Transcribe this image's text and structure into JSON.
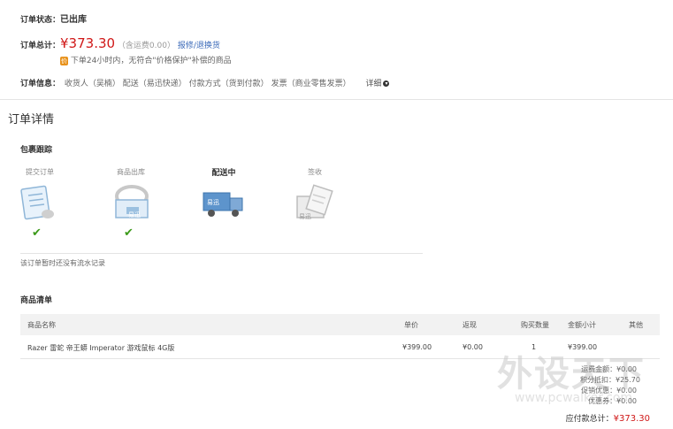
{
  "order": {
    "status_label": "订单状态：",
    "status_value": "已出库",
    "total_label": "订单总计：",
    "total_value": "¥373.30",
    "freight_note": "（含运费0.00）",
    "repair_link": "报修/退换货",
    "guarantee_text": "下单24小时内，无符合\"价格保护\"补偿的商品",
    "guarantee_icon_char": "价",
    "info_label": "订单信息：",
    "info_items": [
      "收货人（吴楠）",
      "配送（易迅快递）",
      "付款方式（货到付款）",
      "发票（商业零售发票）"
    ],
    "detail_label": "详细",
    "detail_icon_char": "▾"
  },
  "details": {
    "title": "订单详情",
    "tracking_title": "包裹跟踪",
    "steps": [
      {
        "label": "提交订单",
        "done": true
      },
      {
        "label": "商品出库",
        "done": true
      },
      {
        "label": "配送中",
        "done": false,
        "current": true
      },
      {
        "label": "签收",
        "done": false
      }
    ],
    "check_char": "✔",
    "no_records": "该订单暂时还没有流水记录",
    "brand_tag": "易迅"
  },
  "product_list": {
    "title": "商品清单",
    "headers": {
      "name": "商品名称",
      "unit_price": "单价",
      "rebate": "返现",
      "qty": "购买数量",
      "subtotal": "金额小计",
      "other": "其他"
    },
    "rows": [
      {
        "name": "Razer 雷蛇 帝王蟒 Imperator 游戏鼠标 4G版",
        "unit_price": "¥399.00",
        "rebate": "¥0.00",
        "qty": "1",
        "subtotal": "¥399.00"
      }
    ],
    "summary": [
      "运费金额：¥0.00",
      "积分抵扣：¥25.70",
      "促销优惠：¥0.00",
      "优惠券：¥0.00"
    ],
    "total_label": "应付款总计：",
    "total_value": "¥373.30"
  },
  "watermark": {
    "main": "外设天下",
    "url": "www.pcwalker.com"
  },
  "colors": {
    "price_red": "#d01818",
    "link_blue": "#3a69b8",
    "check_green": "#3c9a1a"
  }
}
